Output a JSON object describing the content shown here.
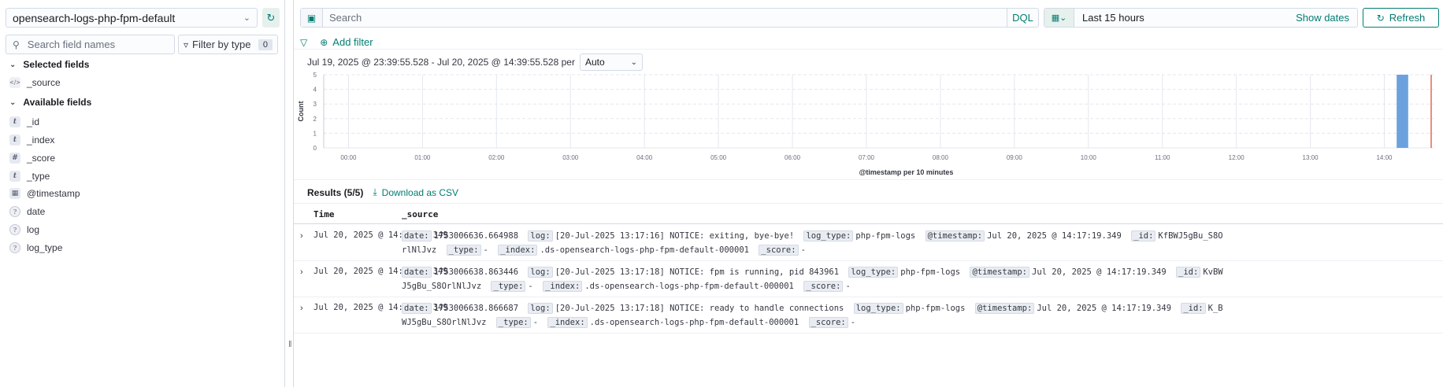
{
  "sidebar": {
    "index_pattern": "opensearch-logs-php-fpm-default",
    "field_search_placeholder": "Search field names",
    "filter_by_type_label": "Filter by type",
    "filter_count": "0",
    "selected_fields_title": "Selected fields",
    "selected_fields": [
      {
        "name": "_source",
        "type": "source"
      }
    ],
    "available_fields_title": "Available fields",
    "available_fields": [
      {
        "name": "_id",
        "type": "string"
      },
      {
        "name": "_index",
        "type": "string"
      },
      {
        "name": "_score",
        "type": "number"
      },
      {
        "name": "_type",
        "type": "string"
      },
      {
        "name": "@timestamp",
        "type": "date"
      },
      {
        "name": "date",
        "type": "unknown"
      },
      {
        "name": "log",
        "type": "unknown"
      },
      {
        "name": "log_type",
        "type": "unknown"
      }
    ],
    "token_glyphs": {
      "string": "t",
      "number": "#",
      "date": "▦",
      "unknown": "?",
      "source": "</>"
    }
  },
  "query_bar": {
    "search_placeholder": "Search",
    "language": "DQL"
  },
  "date_picker": {
    "range": "Last 15 hours",
    "show_dates_label": "Show dates",
    "refresh_label": "Refresh"
  },
  "filters": {
    "add_filter_label": "Add filter"
  },
  "histogram": {
    "range_label": "Jul 19, 2025 @ 23:39:55.528 - Jul 20, 2025 @ 14:39:55.528 per",
    "interval": "Auto"
  },
  "chart_data": {
    "type": "bar",
    "xlabel": "@timestamp per 10 minutes",
    "ylabel": "Count",
    "ylim": [
      0,
      5
    ],
    "yticks": [
      0,
      1,
      2,
      3,
      4,
      5
    ],
    "x_ticks": [
      "00:00",
      "01:00",
      "02:00",
      "03:00",
      "04:00",
      "05:00",
      "06:00",
      "07:00",
      "08:00",
      "09:00",
      "10:00",
      "11:00",
      "12:00",
      "13:00",
      "14:00"
    ],
    "x_start": "23:39:55",
    "x_end": "14:39:55",
    "bars": [
      {
        "x": "14:10",
        "value": 5
      }
    ],
    "now_marker": "14:39:55",
    "bar_color": "#6ba2de",
    "now_color": "#e7664c"
  },
  "results": {
    "title": "Results (5/5)",
    "download_label": "Download as CSV",
    "columns": [
      "Time",
      "_source"
    ],
    "rows": [
      {
        "time": "Jul 20, 2025 @ 14:17:19.349",
        "source": [
          [
            "date:",
            "1753006636.664988"
          ],
          [
            "log:",
            "[20-Jul-2025 13:17:16] NOTICE: exiting, bye-bye!"
          ],
          [
            "log_type:",
            "php-fpm-logs"
          ],
          [
            "@timestamp:",
            "Jul 20, 2025 @ 14:17:19.349"
          ],
          [
            "_id:",
            "KfBWJ5gBu_S8OrlNlJvz"
          ],
          [
            "_type:",
            "-"
          ],
          [
            "_index:",
            ".ds-opensearch-logs-php-fpm-default-000001"
          ],
          [
            "_score:",
            "-"
          ]
        ]
      },
      {
        "time": "Jul 20, 2025 @ 14:17:19.349",
        "source": [
          [
            "date:",
            "1753006638.863446"
          ],
          [
            "log:",
            "[20-Jul-2025 13:17:18] NOTICE: fpm is running, pid 843961"
          ],
          [
            "log_type:",
            "php-fpm-logs"
          ],
          [
            "@timestamp:",
            "Jul 20, 2025 @ 14:17:19.349"
          ],
          [
            "_id:",
            "KvBWJ5gBu_S8OrlNlJvz"
          ],
          [
            "_type:",
            "-"
          ],
          [
            "_index:",
            ".ds-opensearch-logs-php-fpm-default-000001"
          ],
          [
            "_score:",
            "-"
          ]
        ]
      },
      {
        "time": "Jul 20, 2025 @ 14:17:19.349",
        "source": [
          [
            "date:",
            "1753006638.866687"
          ],
          [
            "log:",
            "[20-Jul-2025 13:17:18] NOTICE: ready to handle connections"
          ],
          [
            "log_type:",
            "php-fpm-logs"
          ],
          [
            "@timestamp:",
            "Jul 20, 2025 @ 14:17:19.349"
          ],
          [
            "_id:",
            "K_BWJ5gBu_S8OrlNlJvz"
          ],
          [
            "_type:",
            "-"
          ],
          [
            "_index:",
            ".ds-opensearch-logs-php-fpm-default-000001"
          ],
          [
            "_score:",
            "-"
          ]
        ]
      }
    ]
  },
  "colors": {
    "accent": "#017d73",
    "border": "#d3dae6"
  }
}
